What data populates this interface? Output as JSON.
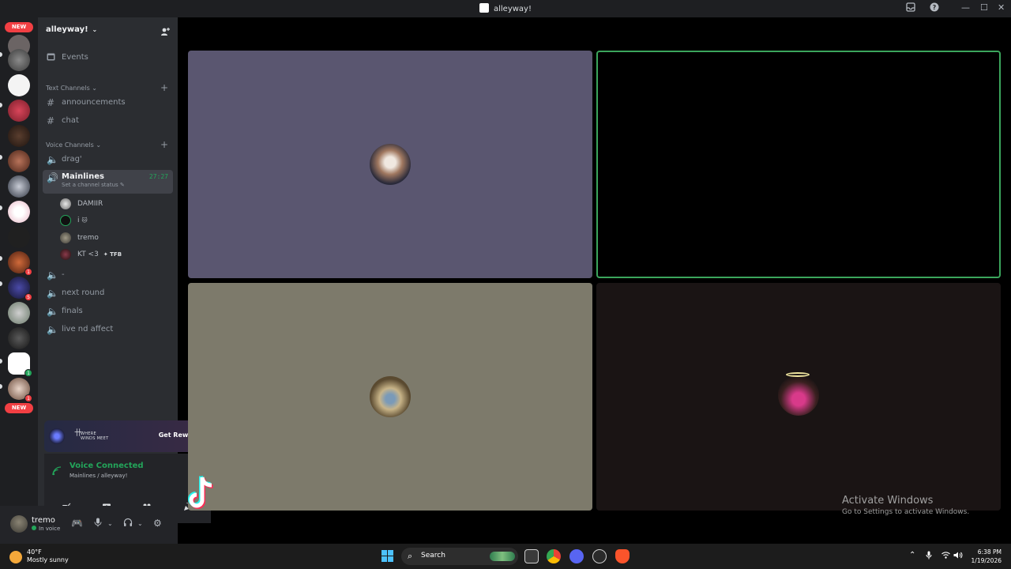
{
  "window": {
    "title": "alleyway!"
  },
  "rail": {
    "new_badge_top": "NEW",
    "new_badge_bottom": "NEW",
    "badges": [
      "1",
      "5",
      "1",
      "1"
    ]
  },
  "guild": {
    "name": "alleyway!"
  },
  "channels": {
    "events_label": "Events",
    "text_category": "Text Channels",
    "text": [
      "announcements",
      "chat"
    ],
    "voice_category": "Voice Channels",
    "voice_top": "drag'",
    "active": {
      "name": "Mainlines",
      "timer": "27:27",
      "status": "Set a channel status"
    },
    "members": [
      {
        "name": "DAMIIR",
        "tag": ""
      },
      {
        "name": "i",
        "tag": ""
      },
      {
        "name": "tremo",
        "tag": ""
      },
      {
        "name": "KT <3",
        "tag": "TFB"
      }
    ],
    "voice_bottom": [
      "-",
      "next round",
      "finals",
      "live nd affect"
    ]
  },
  "promo": {
    "art_line1": "WHERE",
    "art_line2": "WINDS MEET",
    "button": "Get Reward!"
  },
  "voice": {
    "status": "Voice Connected",
    "location": "Mainlines / alleyway!"
  },
  "user": {
    "name": "tremo",
    "status": "In voice"
  },
  "activate": {
    "title": "Activate Windows",
    "subtitle": "Go to Settings to activate Windows."
  },
  "taskbar": {
    "temp": "40°F",
    "condition": "Mostly sunny",
    "search": "Search",
    "time": "6:38 PM",
    "date": "1/19/2026"
  },
  "colors": {
    "speaking_border": "#3ba55c",
    "voice_green": "#23a55a",
    "tile1": "#5a5670",
    "tile3": "#7d7a6b",
    "tile4": "#1a1414"
  }
}
